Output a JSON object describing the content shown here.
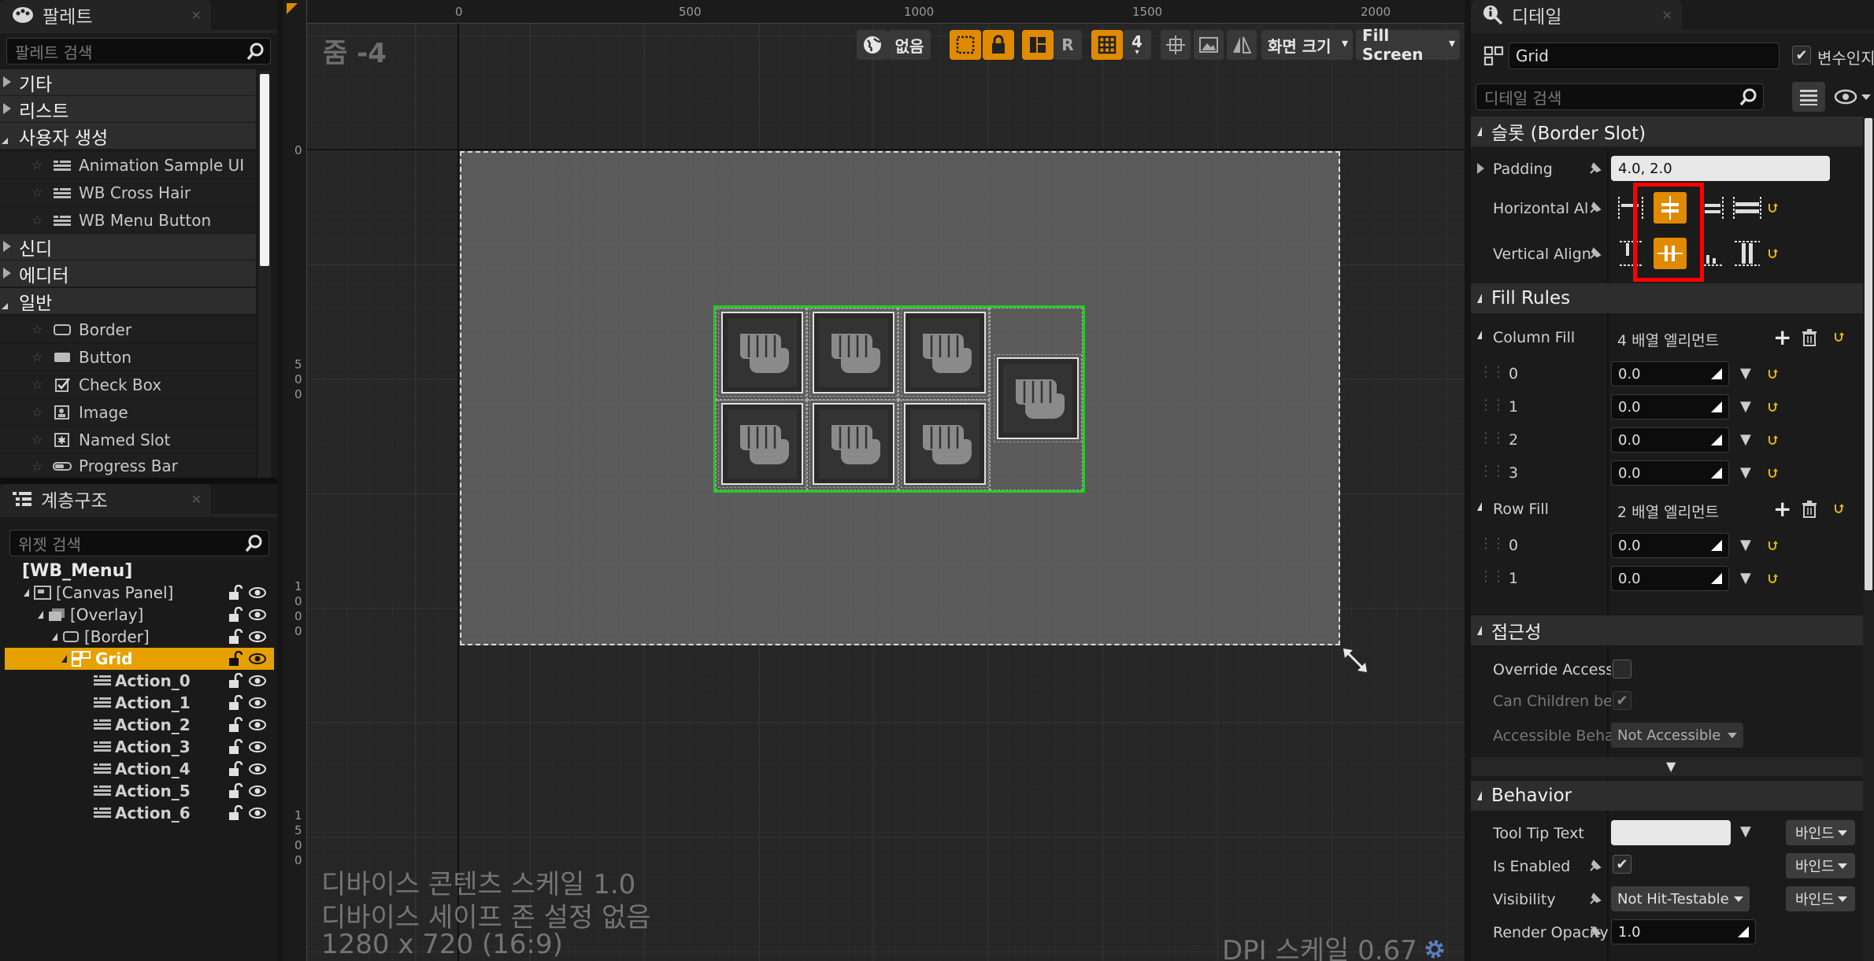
{
  "palette": {
    "tab_title": "팔레트",
    "search_placeholder": "팔레트 검색",
    "categories": [
      {
        "label": "기타",
        "open": false
      },
      {
        "label": "리스트",
        "open": false
      },
      {
        "label": "사용자 생성",
        "open": true
      },
      {
        "label": "신디",
        "open": false
      },
      {
        "label": "에디터",
        "open": false
      },
      {
        "label": "일반",
        "open": true
      }
    ],
    "user_items": [
      "Animation Sample UI",
      "WB Cross Hair",
      "WB Menu Button"
    ],
    "common_items": [
      "Border",
      "Button",
      "Check Box",
      "Image",
      "Named Slot",
      "Progress Bar"
    ]
  },
  "hierarchy": {
    "tab_title": "계층구조",
    "search_placeholder": "위젯 검색",
    "root": "[WB_Menu]",
    "rows": [
      {
        "label": "[Canvas Panel]"
      },
      {
        "label": "[Overlay]"
      },
      {
        "label": "[Border]"
      },
      {
        "label": "Grid",
        "selected": true
      },
      {
        "label": "Action_0"
      },
      {
        "label": "Action_1"
      },
      {
        "label": "Action_2"
      },
      {
        "label": "Action_3"
      },
      {
        "label": "Action_4"
      },
      {
        "label": "Action_5"
      },
      {
        "label": "Action_6"
      }
    ]
  },
  "viewport": {
    "zoom_label": "줌 -4",
    "ruler_top": [
      "0",
      "500",
      "1000",
      "1500",
      "2000"
    ],
    "ruler_left": [
      "0",
      "5\n0\n0",
      "1\n0\n0\n0",
      "1\n5\n0\n0"
    ],
    "toolbar": {
      "none_label": "없음",
      "r_label": "R",
      "grid_count": "4",
      "screen_size_label": "화면 크기",
      "fill_screen_label": "Fill Screen"
    },
    "info_line1": "디바이스 콘텐츠 스케일 1.0",
    "info_line2": "디바이스 세이프 존 설정 없음",
    "info_line3": "1280 x 720 (16:9)",
    "dpi_label": "DPI 스케일 0.67"
  },
  "details": {
    "tab_title": "디테일",
    "name_value": "Grid",
    "variable_label": "변수인지",
    "search_placeholder": "디테일 검색",
    "slot_section": "슬롯 (Border Slot)",
    "padding_label": "Padding",
    "padding_value": "4.0, 2.0",
    "h_align_label": "Horizontal Al",
    "v_align_label": "Vertical Align",
    "fill_rules_section": "Fill Rules",
    "column_fill_label": "Column Fill",
    "column_fill_count": "4 배열 엘리먼트",
    "column_fill": [
      {
        "index": "0",
        "value": "0.0"
      },
      {
        "index": "1",
        "value": "0.0"
      },
      {
        "index": "2",
        "value": "0.0"
      },
      {
        "index": "3",
        "value": "0.0"
      }
    ],
    "row_fill_label": "Row Fill",
    "row_fill_count": "2 배열 엘리먼트",
    "row_fill": [
      {
        "index": "0",
        "value": "0.0"
      },
      {
        "index": "1",
        "value": "0.0"
      }
    ],
    "accessibility_section": "접근성",
    "override_access_label": "Override Access",
    "can_children_label": "Can Children be",
    "accessible_beh_label": "Accessible Beha",
    "accessible_beh_value": "Not Accessible",
    "behavior_section": "Behavior",
    "tooltip_label": "Tool Tip Text",
    "bind_label": "바인드",
    "is_enabled_label": "Is Enabled",
    "visibility_label": "Visibility",
    "visibility_value": "Not Hit-Testable",
    "render_opacity_label": "Render Opacity",
    "render_opacity_value": "1.0"
  },
  "colors": {
    "accent": "#e08a00",
    "selection": "#e6a100",
    "grid_outline": "#22cc22",
    "highlight": "#ff0000"
  }
}
